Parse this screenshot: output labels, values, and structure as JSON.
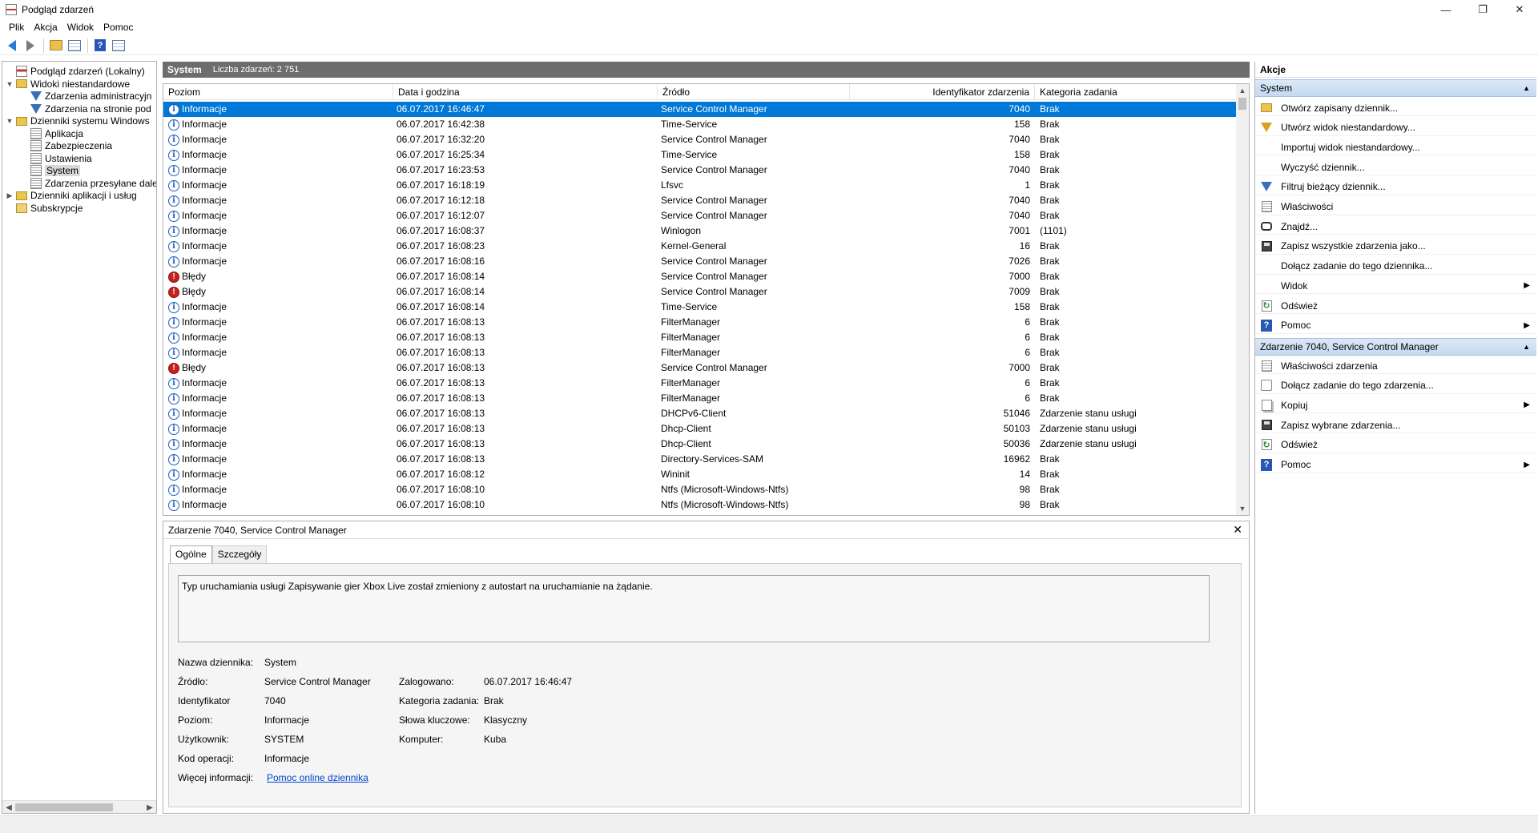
{
  "window": {
    "title": "Podgląd zdarzeń",
    "minimize": "—",
    "restore": "❐",
    "close": "✕"
  },
  "menu": [
    "Plik",
    "Akcja",
    "Widok",
    "Pomoc"
  ],
  "tree": {
    "items": [
      {
        "label": "Podgląd zdarzeń (Lokalny)",
        "icon": "event-viewer-icon",
        "level": 0,
        "expander": ""
      },
      {
        "label": "Widoki niestandardowe",
        "icon": "folder-icon",
        "level": 0,
        "expander": "▼"
      },
      {
        "label": "Zdarzenia administracyjn",
        "icon": "filter-icon",
        "level": 1,
        "expander": ""
      },
      {
        "label": "Zdarzenia na stronie pod",
        "icon": "filter-icon",
        "level": 1,
        "expander": ""
      },
      {
        "label": "Dzienniki systemu Windows",
        "icon": "folder-icon",
        "level": 0,
        "expander": "▼"
      },
      {
        "label": "Aplikacja",
        "icon": "log-icon",
        "level": 1,
        "expander": ""
      },
      {
        "label": "Zabezpieczenia",
        "icon": "log-icon",
        "level": 1,
        "expander": ""
      },
      {
        "label": "Ustawienia",
        "icon": "log-icon",
        "level": 1,
        "expander": ""
      },
      {
        "label": "System",
        "icon": "log-icon",
        "level": 1,
        "expander": "",
        "selected": true
      },
      {
        "label": "Zdarzenia przesyłane dale",
        "icon": "log-icon",
        "level": 1,
        "expander": ""
      },
      {
        "label": "Dzienniki aplikacji i usług",
        "icon": "folder-icon",
        "level": 0,
        "expander": "▶"
      },
      {
        "label": "Subskrypcje",
        "icon": "subscriptions-icon",
        "level": 0,
        "expander": ""
      }
    ]
  },
  "center": {
    "title": "System",
    "count": "Liczba zdarzeń: 2 751",
    "columns": [
      "Poziom",
      "Data i godzina",
      "Źródło",
      "Identyfikator zdarzenia",
      "Kategoria zadania"
    ],
    "rows": [
      {
        "level": "Informacje",
        "type": "info",
        "date": "06.07.2017 16:46:47",
        "source": "Service Control Manager",
        "id": "7040",
        "category": "Brak",
        "selected": true
      },
      {
        "level": "Informacje",
        "type": "info",
        "date": "06.07.2017 16:42:38",
        "source": "Time-Service",
        "id": "158",
        "category": "Brak"
      },
      {
        "level": "Informacje",
        "type": "info",
        "date": "06.07.2017 16:32:20",
        "source": "Service Control Manager",
        "id": "7040",
        "category": "Brak"
      },
      {
        "level": "Informacje",
        "type": "info",
        "date": "06.07.2017 16:25:34",
        "source": "Time-Service",
        "id": "158",
        "category": "Brak"
      },
      {
        "level": "Informacje",
        "type": "info",
        "date": "06.07.2017 16:23:53",
        "source": "Service Control Manager",
        "id": "7040",
        "category": "Brak"
      },
      {
        "level": "Informacje",
        "type": "info",
        "date": "06.07.2017 16:18:19",
        "source": "Lfsvc",
        "id": "1",
        "category": "Brak"
      },
      {
        "level": "Informacje",
        "type": "info",
        "date": "06.07.2017 16:12:18",
        "source": "Service Control Manager",
        "id": "7040",
        "category": "Brak"
      },
      {
        "level": "Informacje",
        "type": "info",
        "date": "06.07.2017 16:12:07",
        "source": "Service Control Manager",
        "id": "7040",
        "category": "Brak"
      },
      {
        "level": "Informacje",
        "type": "info",
        "date": "06.07.2017 16:08:37",
        "source": "Winlogon",
        "id": "7001",
        "category": "(1101)"
      },
      {
        "level": "Informacje",
        "type": "info",
        "date": "06.07.2017 16:08:23",
        "source": "Kernel-General",
        "id": "16",
        "category": "Brak"
      },
      {
        "level": "Informacje",
        "type": "info",
        "date": "06.07.2017 16:08:16",
        "source": "Service Control Manager",
        "id": "7026",
        "category": "Brak"
      },
      {
        "level": "Błędy",
        "type": "error",
        "date": "06.07.2017 16:08:14",
        "source": "Service Control Manager",
        "id": "7000",
        "category": "Brak"
      },
      {
        "level": "Błędy",
        "type": "error",
        "date": "06.07.2017 16:08:14",
        "source": "Service Control Manager",
        "id": "7009",
        "category": "Brak"
      },
      {
        "level": "Informacje",
        "type": "info",
        "date": "06.07.2017 16:08:14",
        "source": "Time-Service",
        "id": "158",
        "category": "Brak"
      },
      {
        "level": "Informacje",
        "type": "info",
        "date": "06.07.2017 16:08:13",
        "source": "FilterManager",
        "id": "6",
        "category": "Brak"
      },
      {
        "level": "Informacje",
        "type": "info",
        "date": "06.07.2017 16:08:13",
        "source": "FilterManager",
        "id": "6",
        "category": "Brak"
      },
      {
        "level": "Informacje",
        "type": "info",
        "date": "06.07.2017 16:08:13",
        "source": "FilterManager",
        "id": "6",
        "category": "Brak"
      },
      {
        "level": "Błędy",
        "type": "error",
        "date": "06.07.2017 16:08:13",
        "source": "Service Control Manager",
        "id": "7000",
        "category": "Brak"
      },
      {
        "level": "Informacje",
        "type": "info",
        "date": "06.07.2017 16:08:13",
        "source": "FilterManager",
        "id": "6",
        "category": "Brak"
      },
      {
        "level": "Informacje",
        "type": "info",
        "date": "06.07.2017 16:08:13",
        "source": "FilterManager",
        "id": "6",
        "category": "Brak"
      },
      {
        "level": "Informacje",
        "type": "info",
        "date": "06.07.2017 16:08:13",
        "source": "DHCPv6-Client",
        "id": "51046",
        "category": "Zdarzenie stanu usługi"
      },
      {
        "level": "Informacje",
        "type": "info",
        "date": "06.07.2017 16:08:13",
        "source": "Dhcp-Client",
        "id": "50103",
        "category": "Zdarzenie stanu usługi"
      },
      {
        "level": "Informacje",
        "type": "info",
        "date": "06.07.2017 16:08:13",
        "source": "Dhcp-Client",
        "id": "50036",
        "category": "Zdarzenie stanu usługi"
      },
      {
        "level": "Informacje",
        "type": "info",
        "date": "06.07.2017 16:08:13",
        "source": "Directory-Services-SAM",
        "id": "16962",
        "category": "Brak"
      },
      {
        "level": "Informacje",
        "type": "info",
        "date": "06.07.2017 16:08:12",
        "source": "Wininit",
        "id": "14",
        "category": "Brak"
      },
      {
        "level": "Informacje",
        "type": "info",
        "date": "06.07.2017 16:08:10",
        "source": "Ntfs (Microsoft-Windows-Ntfs)",
        "id": "98",
        "category": "Brak"
      },
      {
        "level": "Informacje",
        "type": "info",
        "date": "06.07.2017 16:08:10",
        "source": "Ntfs (Microsoft-Windows-Ntfs)",
        "id": "98",
        "category": "Brak"
      }
    ]
  },
  "detail": {
    "title": "Zdarzenie 7040, Service Control Manager",
    "close": "✕",
    "tabs": [
      "Ogólne",
      "Szczegóły"
    ],
    "description": "Typ uruchamiania usługi Zapisywanie gier Xbox Live został zmieniony z autostart na uruchamianie na żądanie.",
    "labels": {
      "log_name": "Nazwa dziennika:",
      "source": "Źródło:",
      "event_id": "Identyfikator",
      "level": "Poziom:",
      "user": "Użytkownik:",
      "opcode": "Kod operacji:",
      "more_info": "Więcej informacji:",
      "logged": "Zalogowano:",
      "task_category": "Kategoria zadania:",
      "keywords": "Słowa kluczowe:",
      "computer": "Komputer:"
    },
    "values": {
      "log_name": "System",
      "source": "Service Control Manager",
      "event_id": "7040",
      "level": "Informacje",
      "user": "SYSTEM",
      "opcode": "Informacje",
      "more_info": "Pomoc online dziennika",
      "logged": "06.07.2017 16:46:47",
      "task_category": "Brak",
      "keywords": "Klasyczny",
      "computer": "Kuba"
    }
  },
  "actions": {
    "title": "Akcje",
    "section1": "System",
    "items1": [
      {
        "label": "Otwórz zapisany dziennik...",
        "icon": "open-log-icon",
        "submenu": false
      },
      {
        "label": "Utwórz widok niestandardowy...",
        "icon": "create-view-icon",
        "submenu": false
      },
      {
        "label": "Importuj widok niestandardowy...",
        "icon": "",
        "submenu": false
      },
      {
        "label": "Wyczyść dziennik...",
        "icon": "",
        "submenu": false
      },
      {
        "label": "Filtruj bieżący dziennik...",
        "icon": "filter-icon",
        "submenu": false
      },
      {
        "label": "Właściwości",
        "icon": "properties-icon",
        "submenu": false
      },
      {
        "label": "Znajdź...",
        "icon": "find-icon",
        "submenu": false
      },
      {
        "label": "Zapisz wszystkie zdarzenia jako...",
        "icon": "save-icon",
        "submenu": false
      },
      {
        "label": "Dołącz zadanie do tego dziennika...",
        "icon": "",
        "submenu": false
      },
      {
        "label": "Widok",
        "icon": "",
        "submenu": true
      },
      {
        "label": "Odśwież",
        "icon": "refresh-icon",
        "submenu": false
      },
      {
        "label": "Pomoc",
        "icon": "help-icon",
        "submenu": true
      }
    ],
    "section2": "Zdarzenie 7040, Service Control Manager",
    "items2": [
      {
        "label": "Właściwości zdarzenia",
        "icon": "event-properties-icon",
        "submenu": false
      },
      {
        "label": "Dołącz zadanie do tego zdarzenia...",
        "icon": "attach-task-icon",
        "submenu": false
      },
      {
        "label": "Kopiuj",
        "icon": "copy-icon",
        "submenu": true
      },
      {
        "label": "Zapisz wybrane zdarzenia...",
        "icon": "save-icon",
        "submenu": false
      },
      {
        "label": "Odśwież",
        "icon": "refresh-icon",
        "submenu": false
      },
      {
        "label": "Pomoc",
        "icon": "help-icon",
        "submenu": true
      }
    ]
  },
  "colors": {
    "selection": "#0078d7",
    "header_bar": "#6d6d6d",
    "section_bg": "#c5d9f0",
    "error": "#c8201d",
    "info": "#1f5fbf"
  }
}
